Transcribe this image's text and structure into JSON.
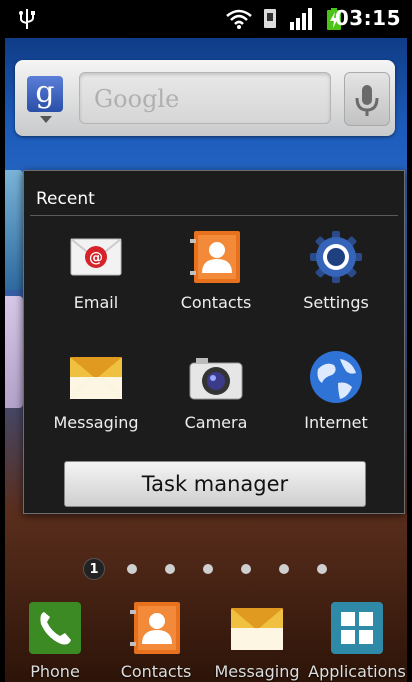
{
  "status_bar": {
    "time": "03:15",
    "icons": [
      "usb-icon",
      "wifi-icon",
      "sim-icon",
      "signal-icon",
      "battery-charging-icon"
    ]
  },
  "search_widget": {
    "logo": "g",
    "placeholder": "Google",
    "icons": [
      "google-logo-icon",
      "microphone-icon"
    ]
  },
  "recent_panel": {
    "title": "Recent",
    "apps": [
      {
        "label": "Email",
        "icon": "email-icon"
      },
      {
        "label": "Contacts",
        "icon": "contacts-icon"
      },
      {
        "label": "Settings",
        "icon": "settings-gear-icon"
      },
      {
        "label": "Messaging",
        "icon": "messaging-envelope-icon"
      },
      {
        "label": "Camera",
        "icon": "camera-icon"
      },
      {
        "label": "Internet",
        "icon": "globe-icon"
      }
    ],
    "task_manager_label": "Task manager"
  },
  "page_indicator": {
    "current": "1",
    "total_pages": 7
  },
  "dock": {
    "items": [
      {
        "label": "Phone",
        "icon": "phone-icon"
      },
      {
        "label": "Contacts",
        "icon": "contacts-icon"
      },
      {
        "label": "Messaging",
        "icon": "messaging-envelope-icon"
      },
      {
        "label": "Applications",
        "icon": "applications-grid-icon"
      }
    ]
  },
  "colors": {
    "panel_bg": "#1c1c1c",
    "status_bar_bg": "#000000",
    "battery_green": "#4cc417"
  }
}
